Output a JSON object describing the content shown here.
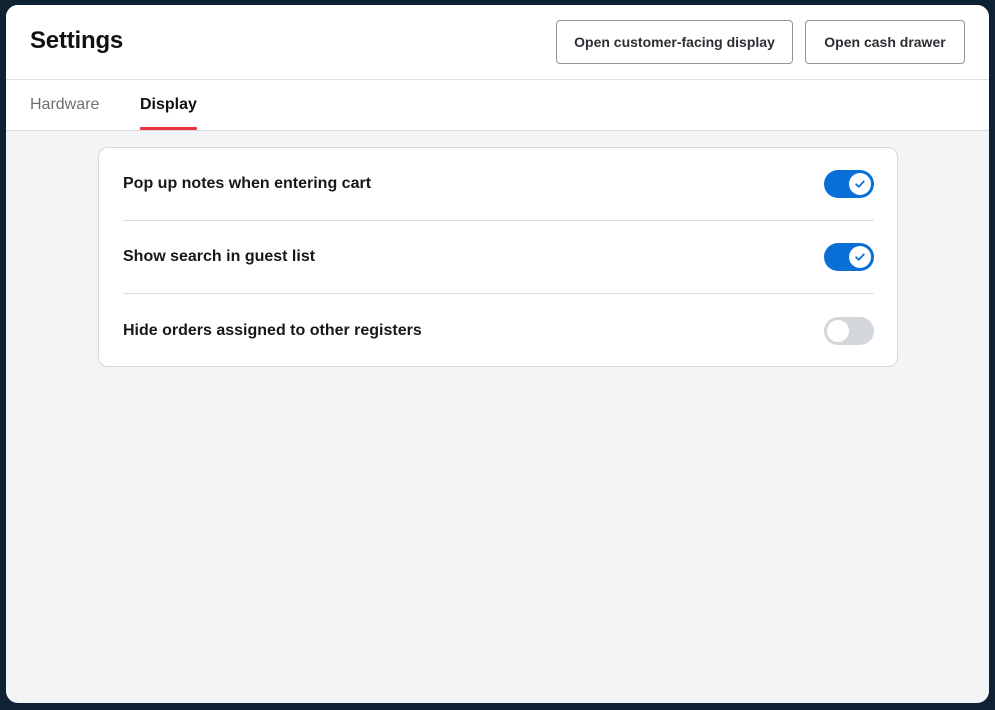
{
  "header": {
    "title": "Settings",
    "buttons": {
      "customer_display": "Open customer-facing display",
      "cash_drawer": "Open cash drawer"
    }
  },
  "tabs": [
    {
      "label": "Hardware",
      "selected": false
    },
    {
      "label": "Display",
      "selected": true
    }
  ],
  "colors": {
    "accent": "#0b6fd8",
    "tab_indicator": "#e8313f",
    "toggle_off": "#d3d6da"
  },
  "settings": [
    {
      "label": "Pop up notes when entering cart",
      "enabled": true,
      "icon": "check-icon"
    },
    {
      "label": "Show search in guest list",
      "enabled": true,
      "icon": "check-icon"
    },
    {
      "label": "Hide orders assigned to other registers",
      "enabled": false
    }
  ]
}
